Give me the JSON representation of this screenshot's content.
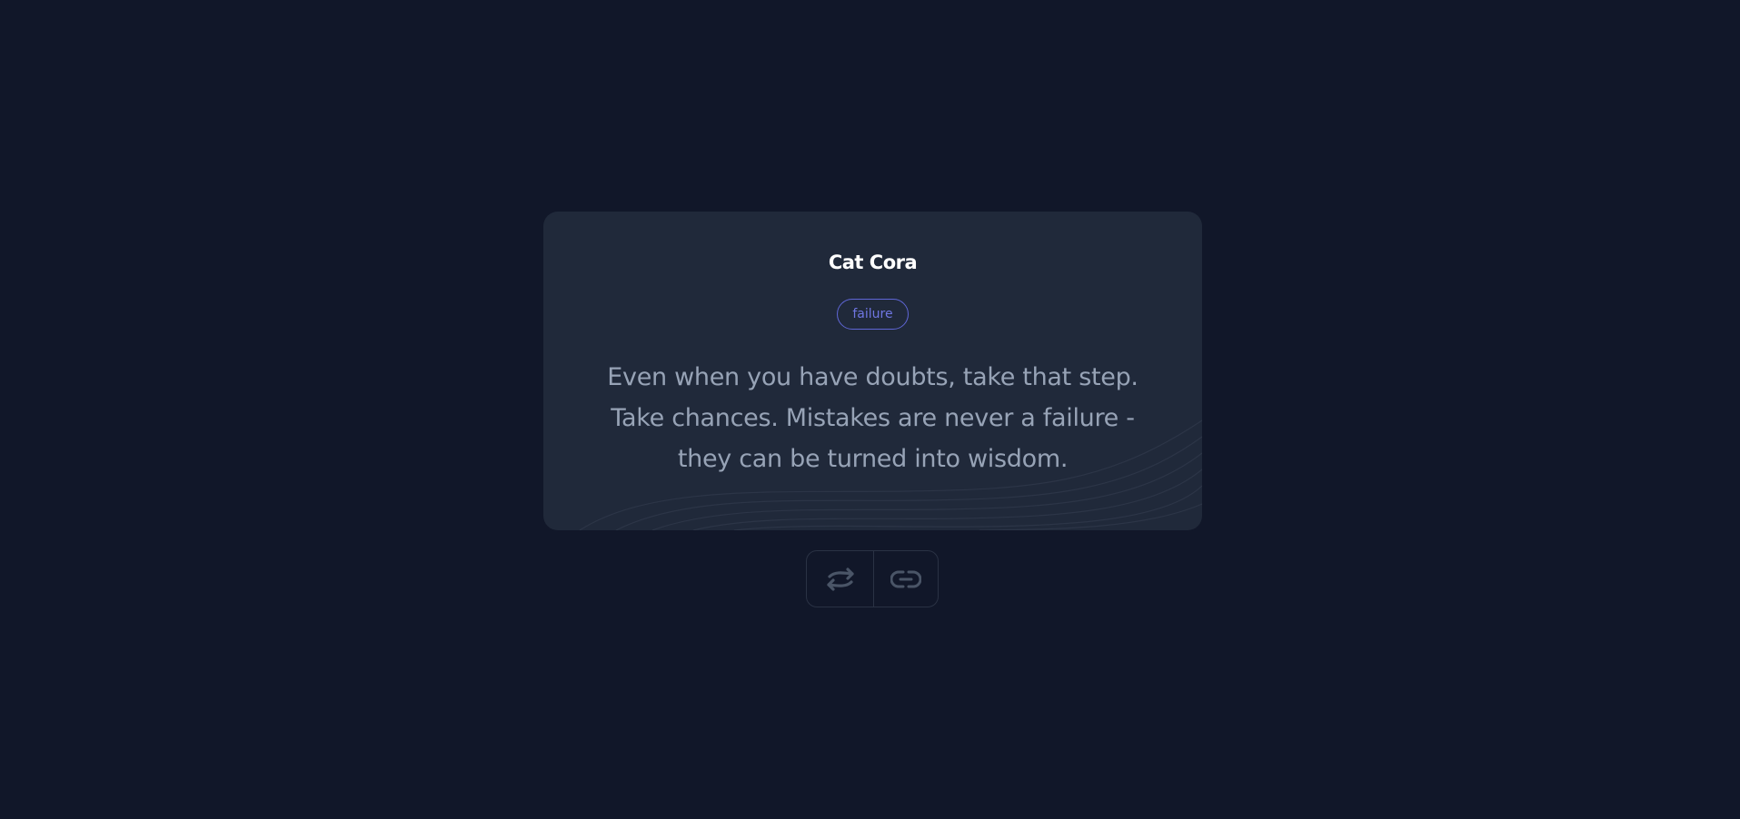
{
  "quote": {
    "author": "Cat Cora",
    "tag": "failure",
    "text_lines": [
      "Even when you have doubts, take that step.",
      "Take chances. Mistakes are never a failure -",
      "they can be turned into wisdom."
    ]
  },
  "actions": {
    "random_icon": "shuffle-arrows-icon",
    "copy_icon": "link-icon"
  },
  "colors": {
    "background": "#111729",
    "card": "#20293a",
    "author": "#ffffff",
    "tag_accent": "#6f76e2",
    "quote_text": "#97a3b6",
    "icon": "#4a5567"
  }
}
